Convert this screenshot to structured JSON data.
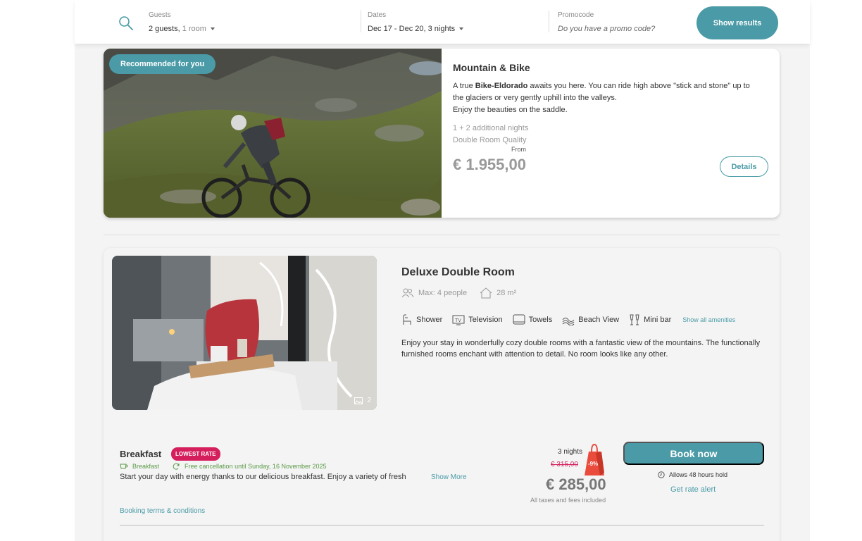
{
  "search": {
    "guests_label": "Guests",
    "guests_value": "2 guests,",
    "guests_rooms": "1 room",
    "dates_label": "Dates",
    "dates_value": "Dec 17 - Dec 20, 3 nights",
    "promo_label": "Promocode",
    "promo_placeholder": "Do you have a promo code?",
    "show_results": "Show results"
  },
  "package": {
    "badge": "Recommended for you",
    "title": "Mountain & Bike",
    "desc_prefix": "A true ",
    "desc_bold": "Bike-Eldorado",
    "desc_suffix": " awaits you here. You can ride high above \"stick and stone\" up to the glaciers or very gently uphill into the valleys.",
    "desc_line2": "Enjoy the beauties on the saddle.",
    "nights": "1 + 2 additional nights",
    "room_quality": "Double Room Quality",
    "from": "From",
    "price": "€ 1.955,00",
    "details": "Details"
  },
  "room": {
    "title": "Deluxe Double Room",
    "max_people": "Max: 4 people",
    "size": "28 m²",
    "gallery_count": "2",
    "amenities": [
      "Shower",
      "Television",
      "Towels",
      "Beach View",
      "Mini bar"
    ],
    "show_all_amenities": "Show all amenities",
    "description": "Enjoy your stay in wonderfully cozy double rooms with a fantastic view of the mountains. The functionally furnished rooms enchant with attention to detail. No room looks like any other."
  },
  "rate": {
    "title": "Breakfast",
    "badge": "LOWEST RATE",
    "tag_board": "Breakfast",
    "tag_cancel": "Free cancellation until Sunday, 16 November 2025",
    "description": "Start your day with energy thanks to our delicious breakfast. Enjoy a variety of fresh",
    "show_more": "Show More",
    "terms": "Booking terms & conditions",
    "nights": "3 nights",
    "old_price": "€ 315,00",
    "discount": "-9%",
    "price": "€ 285,00",
    "taxes": "All taxes and fees included",
    "book_now": "Book now",
    "hold": "Allows 48 hours hold",
    "rate_alert": "Get rate alert"
  },
  "colors": {
    "accent": "#4a9ba7",
    "badge_pink": "#d51f5d",
    "sale_red": "#e94b3c",
    "green": "#5a9a46"
  }
}
